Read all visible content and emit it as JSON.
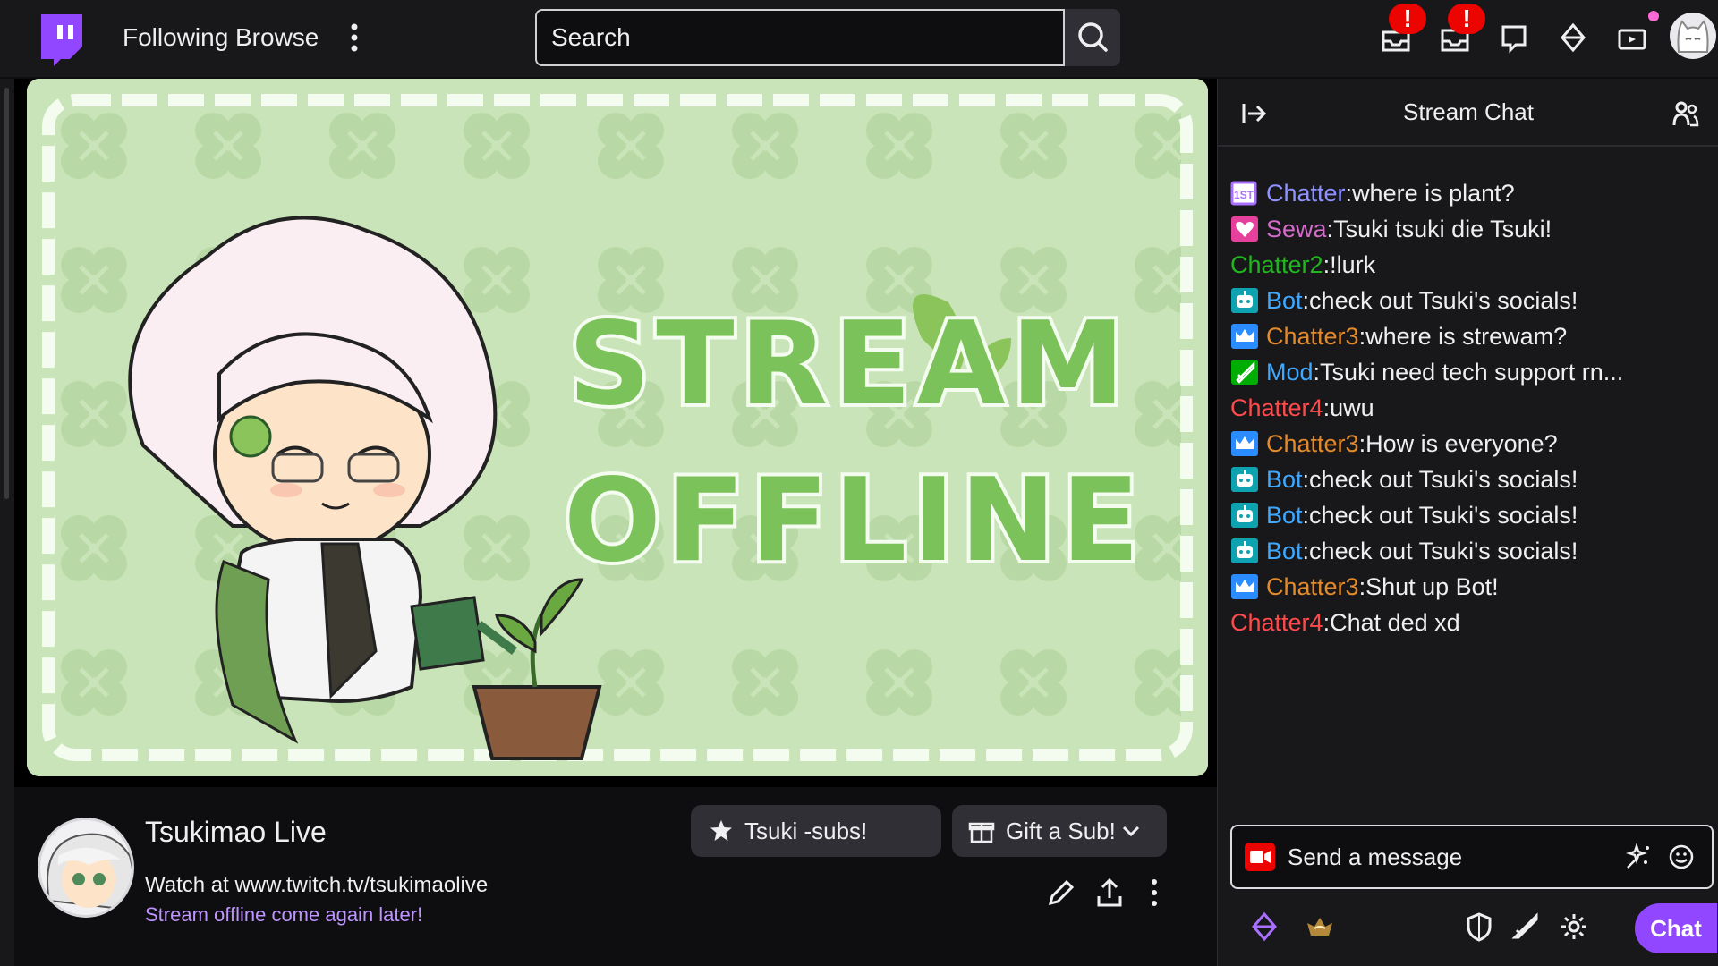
{
  "nav": {
    "following": "Following",
    "browse": "Browse",
    "search_placeholder": "Search",
    "notification_badge_1": "!",
    "notification_badge_2": "!"
  },
  "stream": {
    "offline_line_1": "STREAM",
    "offline_line_2": "OFFLINE"
  },
  "channel": {
    "name": "Tsukimao Live",
    "title": "Watch at www.twitch.tv/tsukimaolive",
    "category": "Stream offline come again later!",
    "subs_button": "Tsuki -subs!",
    "gift_button": "Gift a Sub!"
  },
  "chat": {
    "title": "Stream Chat",
    "messages": [
      {
        "badge": "first-msg",
        "name": "Chatter",
        "color": "#8f93ff",
        "text": "where is plant?"
      },
      {
        "badge": "heart",
        "name": "Sewa",
        "color": "#d36cc9",
        "text": "Tsuki tsuki die Tsuki!"
      },
      {
        "badge": "",
        "name": "Chatter2",
        "color": "#22b51f",
        "text": "!lurk"
      },
      {
        "badge": "bot",
        "name": "Bot",
        "color": "#3fa9ff",
        "text": "check out Tsuki's socials!"
      },
      {
        "badge": "crown",
        "name": "Chatter3",
        "color": "#e38a2b",
        "text": "where is strewam?"
      },
      {
        "badge": "sword",
        "name": "Mod",
        "color": "#3fa9ff",
        "text": "Tsuki need tech support rn..."
      },
      {
        "badge": "",
        "name": "Chatter4",
        "color": "#ff4a4a",
        "text": "uwu"
      },
      {
        "badge": "crown",
        "name": "Chatter3",
        "color": "#e38a2b",
        "text": "How is everyone?"
      },
      {
        "badge": "bot",
        "name": "Bot",
        "color": "#3fa9ff",
        "text": "check out Tsuki's socials!"
      },
      {
        "badge": "bot",
        "name": "Bot",
        "color": "#3fa9ff",
        "text": "check out Tsuki's socials!"
      },
      {
        "badge": "bot",
        "name": "Bot",
        "color": "#3fa9ff",
        "text": "check out Tsuki's socials!"
      },
      {
        "badge": "crown",
        "name": "Chatter3",
        "color": "#e38a2b",
        "text": "Shut up Bot!"
      },
      {
        "badge": "",
        "name": "Chatter4",
        "color": "#ff4a4a",
        "text": "Chat ded xd"
      }
    ],
    "input_placeholder": "Send a message",
    "send_button": "Chat"
  },
  "colors": {
    "accent": "#9147ff",
    "background": "#0e0e10",
    "panel": "#18181b",
    "offline_bg": "#c9e4b8",
    "offline_text": "#7cc25a"
  }
}
